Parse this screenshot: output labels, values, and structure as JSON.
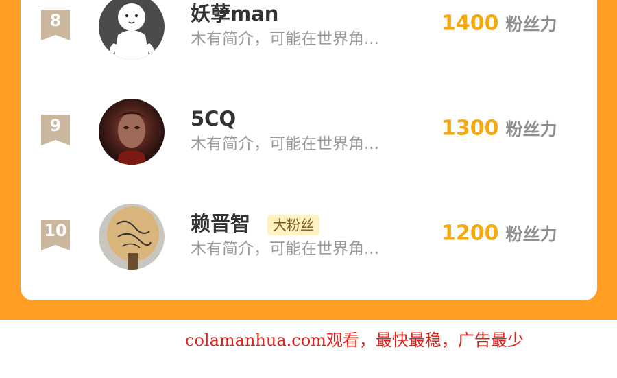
{
  "colors": {
    "background_orange": "#ff9e22",
    "fans_number": "#f5a90f",
    "rank_badge": "#cbb79d",
    "footer_text": "#e0201a"
  },
  "leaderboard": [
    {
      "rank": "8",
      "name": "妖孽man",
      "tag": "",
      "intro": "木有简介，可能在世界角...",
      "fans": "1400",
      "fans_unit": "粉丝力",
      "avatar": "ghost-avatar"
    },
    {
      "rank": "9",
      "name": "5CQ",
      "tag": "",
      "intro": "木有简介，可能在世界角...",
      "fans": "1300",
      "fans_unit": "粉丝力",
      "avatar": "portrait-avatar"
    },
    {
      "rank": "10",
      "name": "赖晋智",
      "tag": "大粉丝",
      "intro": "木有简介，可能在世界角...",
      "fans": "1200",
      "fans_unit": "粉丝力",
      "avatar": "paddle-avatar"
    }
  ],
  "footer": {
    "text": "colamanhua.com观看，最快最稳，广告最少"
  }
}
